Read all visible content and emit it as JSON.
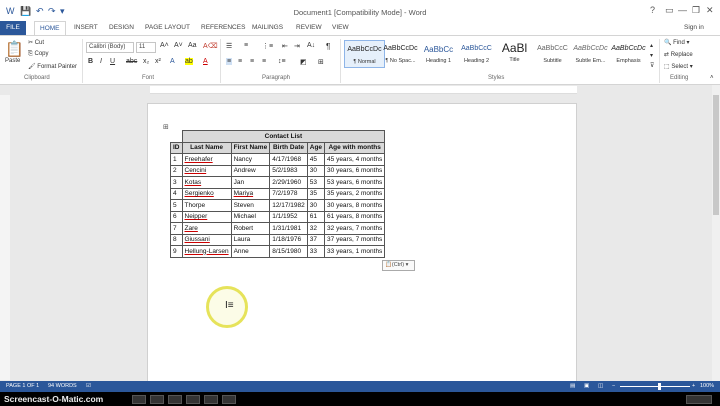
{
  "window": {
    "title": "Document1 [Compatibility Mode] - Word",
    "sign_in": "Sign in",
    "help": "?",
    "minimize": "—",
    "restore": "❐",
    "close": "✕"
  },
  "tabs": [
    "FILE",
    "HOME",
    "INSERT",
    "DESIGN",
    "PAGE LAYOUT",
    "REFERENCES",
    "MAILINGS",
    "REVIEW",
    "VIEW"
  ],
  "ribbon": {
    "clipboard": {
      "paste": "Paste",
      "cut": "Cut",
      "copy": "Copy",
      "format_painter": "Format Painter",
      "label": "Clipboard"
    },
    "font": {
      "family": "Calibri (Body)",
      "size": "11",
      "label": "Font"
    },
    "paragraph": {
      "label": "Paragraph"
    },
    "styles": {
      "label": "Styles",
      "items": [
        {
          "sample": "AaBbCcDc",
          "name": "¶ Normal"
        },
        {
          "sample": "AaBbCcDc",
          "name": "¶ No Spac..."
        },
        {
          "sample": "AaBbCc",
          "name": "Heading 1"
        },
        {
          "sample": "AaBbCcC",
          "name": "Heading 2"
        },
        {
          "sample": "AaBl",
          "name": "Title"
        },
        {
          "sample": "AaBbCcC",
          "name": "Subtitle"
        },
        {
          "sample": "AaBbCcDc",
          "name": "Subtle Em..."
        },
        {
          "sample": "AaBbCcDc",
          "name": "Emphasis"
        }
      ]
    },
    "editing": {
      "find": "Find",
      "replace": "Replace",
      "select": "Select",
      "label": "Editing"
    }
  },
  "table": {
    "caption": "Contact List",
    "headers": [
      "ID",
      "Last Name",
      "First Name",
      "Birth Date",
      "Age",
      "Age with months"
    ],
    "rows": [
      [
        "1",
        "Freehafer",
        "Nancy",
        "4/17/1968",
        "45",
        "45 years, 4 months"
      ],
      [
        "2",
        "Cencini",
        "Andrew",
        "5/2/1983",
        "30",
        "30 years, 6 months"
      ],
      [
        "3",
        "Kotas",
        "Jan",
        "2/29/1960",
        "53",
        "53 years, 6 months"
      ],
      [
        "4",
        "Sergienko",
        "Mariya",
        "7/2/1978",
        "35",
        "35 years, 2 months"
      ],
      [
        "5",
        "Thorpe",
        "Steven",
        "12/17/1982",
        "30",
        "30 years, 8 months"
      ],
      [
        "6",
        "Neipper",
        "Michael",
        "1/1/1952",
        "61",
        "61 years, 8 months"
      ],
      [
        "7",
        "Zare",
        "Robert",
        "1/31/1981",
        "32",
        "32 years, 7 months"
      ],
      [
        "8",
        "Giussani",
        "Laura",
        "1/18/1976",
        "37",
        "37 years, 7 months"
      ],
      [
        "9",
        "Hellung-Larsen",
        "Anne",
        "8/15/1980",
        "33",
        "33 years, 1 months"
      ]
    ]
  },
  "paste_options": "(Ctrl) ▾",
  "status": {
    "page": "PAGE 1 OF 1",
    "words": "94 WORDS",
    "zoom": "100%"
  },
  "watermark": "Screencast-O-Matic.com"
}
